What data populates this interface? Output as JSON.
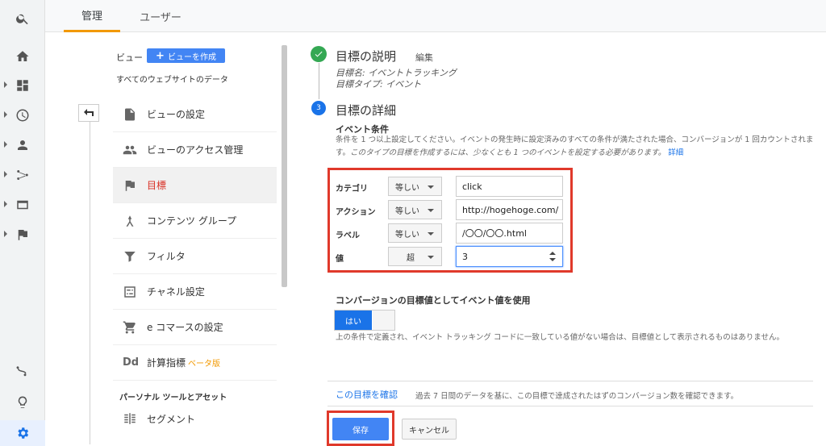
{
  "tabs": {
    "admin": "管理",
    "user": "ユーザー"
  },
  "rail_icons": [
    "search-icon",
    "home-icon",
    "dashboard-icon",
    "clock-icon",
    "person-icon",
    "acquisition-icon",
    "behavior-icon",
    "flag-icon",
    "discover-icon",
    "lightbulb-icon",
    "gear-icon"
  ],
  "nav": {
    "view_label": "ビュー",
    "create_view": "ビューを作成",
    "view_name": "すべてのウェブサイトのデータ",
    "items": [
      {
        "label": "ビューの設定",
        "icon": "doc-icon"
      },
      {
        "label": "ビューのアクセス管理",
        "icon": "people-icon"
      },
      {
        "label": "目標",
        "icon": "flag-icon"
      },
      {
        "label": "コンテンツ グループ",
        "icon": "group-icon"
      },
      {
        "label": "フィルタ",
        "icon": "filter-icon"
      },
      {
        "label": "チャネル設定",
        "icon": "channel-icon"
      },
      {
        "label": "e コマースの設定",
        "icon": "cart-icon"
      },
      {
        "label": "計算指標",
        "icon": "dd-icon",
        "badge": "ベータ版"
      }
    ],
    "section_title": "パーソナル ツールとアセット",
    "segment_label": "セグメント"
  },
  "goal_desc": {
    "title": "目標の説明",
    "edit": "編集",
    "name_line": "目標名: イベントトラッキング",
    "type_line": "目標タイプ: イベント"
  },
  "goal_details": {
    "step_number": "3",
    "title": "目標の詳細",
    "section": "イベント条件",
    "help_plain": "条件を 1 つ以上設定してください。イベントの発生時に設定済みのすべての条件が満たされた場合、コンバージョンが 1 回カウントされます。",
    "help_italic": "このタイプの目標を作成するには、少なくとも 1 つのイベントを設定する必要があります。",
    "help_link": "詳細"
  },
  "conditions": [
    {
      "label": "カテゴリ",
      "operator": "等しい",
      "value": "click"
    },
    {
      "label": "アクション",
      "operator": "等しい",
      "value": "http://hogehoge.com/"
    },
    {
      "label": "ラベル",
      "operator": "等しい",
      "value": "/〇〇/〇〇.html"
    },
    {
      "label": "値",
      "operator": "超",
      "value": "3"
    }
  ],
  "conversion": {
    "title": "コンバージョンの目標値としてイベント値を使用",
    "toggle_on": "はい",
    "help": "上の条件で定義され、イベント トラッキング コードに一致している値がない場合は、目標値として表示されるものはありません。"
  },
  "verify": {
    "link": "この目標を確認",
    "desc": "過去 7 日間のデータを基に、この目標で達成されたはずのコンバージョン数を確認できます。"
  },
  "actions": {
    "save": "保存",
    "cancel": "キャンセル"
  },
  "colors": {
    "accent": "#1a73e8",
    "highlight": "#e0392b",
    "success": "#34a853",
    "tab_underline": "#f29900",
    "active_nav": "#d93025"
  }
}
